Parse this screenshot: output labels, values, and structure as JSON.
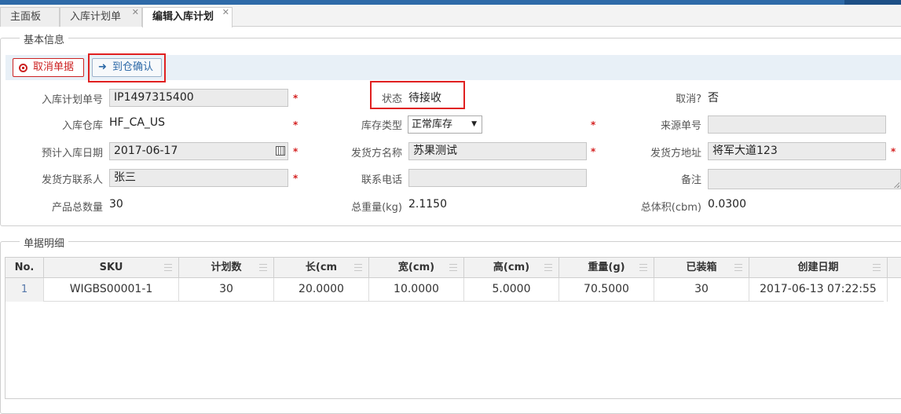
{
  "tabs": [
    {
      "label": "主面板",
      "closable": false
    },
    {
      "label": "入库计划单",
      "closable": true
    },
    {
      "label": "编辑入库计划",
      "closable": true,
      "active": true
    }
  ],
  "basic_info": {
    "legend": "基本信息",
    "toolbar": {
      "cancel_label": "取消单据",
      "confirm_label": "到仓确认"
    },
    "fields": {
      "plan_no": {
        "label": "入库计划单号",
        "value": "IP1497315400"
      },
      "status": {
        "label": "状态",
        "value": "待接收"
      },
      "cancelled": {
        "label": "取消?",
        "value": "否"
      },
      "warehouse": {
        "label": "入库仓库",
        "value": "HF_CA_US"
      },
      "stock_type": {
        "label": "库存类型",
        "value": "正常库存"
      },
      "source_no": {
        "label": "来源单号",
        "value": ""
      },
      "expected_date": {
        "label": "预计入库日期",
        "value": "2017-06-17"
      },
      "shipper_name": {
        "label": "发货方名称",
        "value": "苏果测试"
      },
      "shipper_address": {
        "label": "发货方地址",
        "value": "将军大道123"
      },
      "shipper_contact": {
        "label": "发货方联系人",
        "value": "张三"
      },
      "phone": {
        "label": "联系电话",
        "value": ""
      },
      "remark": {
        "label": "备注",
        "value": ""
      },
      "total_qty": {
        "label": "产品总数量",
        "value": "30"
      },
      "total_weight": {
        "label": "总重量(kg)",
        "value": "2.1150"
      },
      "total_volume": {
        "label": "总体积(cbm)",
        "value": "0.0300"
      }
    },
    "required_mark": "*"
  },
  "detail": {
    "legend": "单据明细",
    "columns": [
      "No.",
      "SKU",
      "计划数",
      "长(cm",
      "宽(cm)",
      "高(cm)",
      "重量(g)",
      "已装箱",
      "创建日期"
    ],
    "rows": [
      [
        "1",
        "WIGBS00001-1",
        "30",
        "20.0000",
        "10.0000",
        "5.0000",
        "70.5000",
        "30",
        "2017-06-13 07:22:55"
      ]
    ]
  },
  "colors": {
    "accent": "#2e6aa8",
    "required": "#d42020",
    "highlight": "#e02020"
  }
}
